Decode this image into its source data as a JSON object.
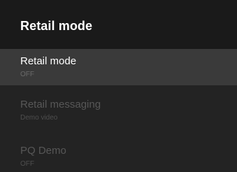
{
  "header": {
    "title": "Retail mode"
  },
  "items": [
    {
      "title": "Retail mode",
      "value": "OFF"
    },
    {
      "title": "Retail messaging",
      "value": "Demo video"
    },
    {
      "title": "PQ Demo",
      "value": "OFF"
    }
  ],
  "colors": {
    "header_bg": "#1a1a1a",
    "panel_bg": "#232323",
    "focused_bg": "#3a3a3a",
    "text_primary": "#ffffff",
    "text_disabled": "#575757"
  }
}
